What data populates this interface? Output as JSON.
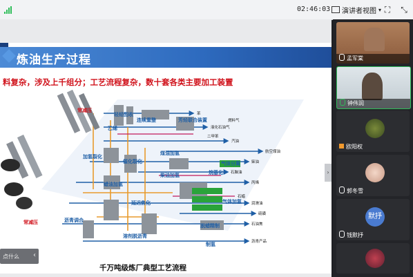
{
  "topbar": {
    "clock": "02:46:03",
    "presenter_view_label": "演讲者视图"
  },
  "slide": {
    "side_tab": "由",
    "title": "炼油生产过程",
    "subtitle": "料复杂，涉及上千组分；工艺流程复杂，数十套各类主要加工装置",
    "caption": "千万吨级炼厂典型工艺流程",
    "left_thumb_text": "点什么"
  },
  "diagram": {
    "units": {
      "u1": "常减压",
      "u2": "常减压",
      "u3": "轻烃回收",
      "u4": "连续重整",
      "u5": "芳烃联合装置",
      "u6": "乙烯",
      "u7": "加氢裂化",
      "u8": "催化裂化",
      "u9": "煤油加氢",
      "u10": "柴油加氢",
      "u11": "延迟焦化",
      "u12": "溶剂脱沥青",
      "u13": "沥青调合",
      "u14": "蜡油加氢",
      "u15": "脱蜡精制",
      "u16": "制氢",
      "u17": "气体加氢",
      "u18": "气体分离",
      "u19": "烷基化"
    },
    "products": {
      "p1": "液化石油气",
      "p2": "汽油",
      "p3": "苯",
      "p4": "二甲苯",
      "p5": "航空煤油",
      "p6": "柴油",
      "p7": "石脑油",
      "p8": "丙烯",
      "p9": "石蜡",
      "p10": "润滑油",
      "p11": "沥青产品",
      "p12": "石油焦",
      "p13": "硫磺",
      "p14": "燃料气"
    }
  },
  "participants": [
    {
      "name": "孟军棠"
    },
    {
      "name": "钟伟润"
    },
    {
      "name": "欧阳权"
    },
    {
      "name": "郭冬雪"
    },
    {
      "name": "钱默抒",
      "avatar_text": "默抒"
    },
    {
      "name": ""
    }
  ],
  "colors": {
    "title_blue": "#2e6bbf",
    "subtitle_red": "#d0121b",
    "pipe_blue": "#1f5fa6",
    "pipe_orange": "#e89a2c",
    "unit_green": "#2aa33a"
  }
}
